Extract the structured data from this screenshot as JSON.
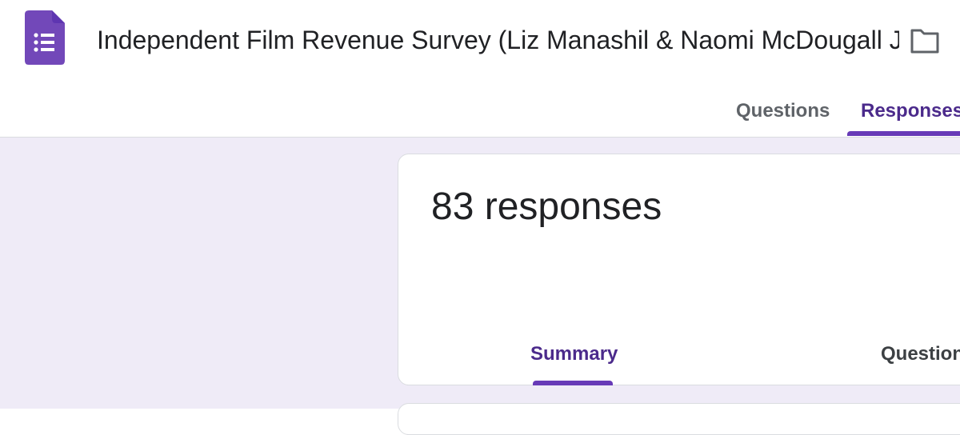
{
  "header": {
    "app_icon": "google-forms-icon",
    "form_title": "Independent Film Revenue Survey (Liz Manashil & Naomi McDougall Jones)",
    "folder_icon": "folder-icon",
    "tabs": [
      {
        "label": "Questions",
        "active": false
      },
      {
        "label": "Responses",
        "active": true
      }
    ]
  },
  "summary_card": {
    "responses_text": "83 responses",
    "tabs": [
      {
        "label": "Summary",
        "active": true
      },
      {
        "label": "Question",
        "active": false
      }
    ]
  },
  "colors": {
    "accent": "#673ab7",
    "active_tab_text": "#4b2a8b",
    "page_background": "#efebf7",
    "title_text": "#202124"
  }
}
